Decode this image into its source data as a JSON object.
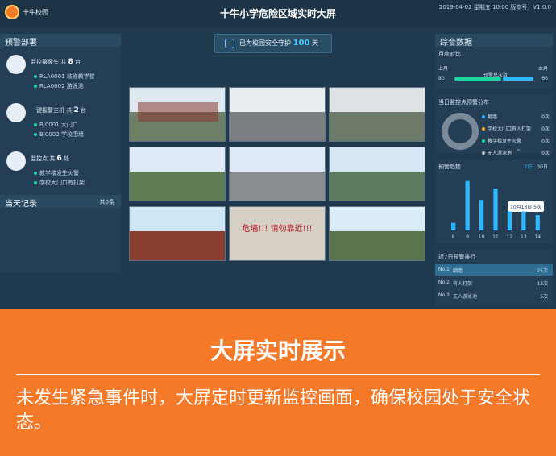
{
  "header": {
    "logo_text": "十牛校园",
    "title": "十牛小学危险区域实时大屏",
    "datetime": "2019-04-02  星期五 10:00  版本号：V1.0.0"
  },
  "left_panel": {
    "title": "预警部署",
    "devices": [
      {
        "name": "监控摄像头",
        "count_label": "共",
        "count": "8",
        "unit": "台",
        "items": [
          "RLA0001  装修教学楼",
          "RLA0002  游泳池"
        ]
      },
      {
        "name": "一键报警主机",
        "count_label": "共",
        "count": "2",
        "unit": "台",
        "items": [
          "BJ0001  大门口",
          "BJ0002  学校围墙"
        ]
      },
      {
        "name": "监控点",
        "count_label": "共",
        "count": "6",
        "unit": "处",
        "items": [
          "教学楼发生火警",
          "学校大门口有打架"
        ]
      }
    ],
    "records_title": "当天记录",
    "records_count": "共0条"
  },
  "center": {
    "banner_text": "已为校园安全守护",
    "banner_days": "100",
    "banner_unit": "天",
    "warning_sign": "危墙!!! 请勿靠近!!!"
  },
  "right_panel": {
    "title": "综合数据",
    "monthly_title": "月度对比",
    "last_month_label": "上月",
    "this_month_label": "本月",
    "last_value": "80",
    "mid_label": "预警总次数",
    "this_value": "66",
    "distribution_title": "当日监控点预警分布",
    "distribution": [
      {
        "label": "翻墙",
        "value": "0次"
      },
      {
        "label": "学校大门口有人打架",
        "value": "0次"
      },
      {
        "label": "教学楼发生火警",
        "value": "0次"
      },
      {
        "label": "无人游泳池",
        "value": "0次"
      }
    ],
    "trend_title": "预警趋势",
    "trend_tabs": [
      "7日",
      "30日"
    ],
    "tooltip": "10月13日  5次",
    "rank_title": "近7日预警排行",
    "rank": [
      {
        "no": "No.1",
        "label": "翻墙",
        "value": "25次"
      },
      {
        "no": "No.2",
        "label": "有人打架",
        "value": "18次"
      },
      {
        "no": "No.3",
        "label": "无人游泳池",
        "value": "5次"
      }
    ]
  },
  "bottom": {
    "heading": "大屏实时展示",
    "description": "未发生紧急事件时，大屏定时更新监控画面，确保校园处于安全状态。"
  },
  "chart_data": {
    "type": "bar",
    "categories": [
      "8",
      "9",
      "10",
      "11",
      "12",
      "13",
      "14"
    ],
    "values": [
      2,
      13,
      8,
      11,
      5,
      5,
      4
    ],
    "ylim": [
      0,
      14
    ]
  }
}
